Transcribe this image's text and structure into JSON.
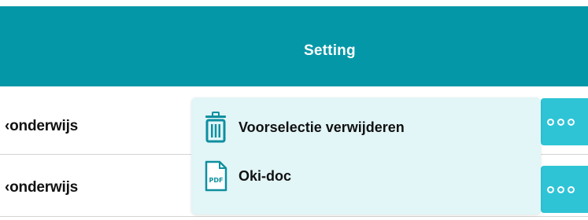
{
  "header": {
    "title": "Setting"
  },
  "rows": [
    {
      "text": "‹onderwijs",
      "more_icon": "more-dots-icon"
    },
    {
      "text": "‹onderwijs",
      "more_icon": "more-dots-icon"
    }
  ],
  "context_menu": {
    "items": [
      {
        "label": "Voorselectie verwijderen",
        "icon": "trash-icon"
      },
      {
        "label": "Oki-doc",
        "icon": "pdf-file-icon",
        "icon_text": "PDF"
      }
    ]
  },
  "colors": {
    "header_bg": "#0497a7",
    "button_bg": "#2ec4d6",
    "menu_bg": "#e2f5f7",
    "icon_color": "#0e8fa0"
  }
}
